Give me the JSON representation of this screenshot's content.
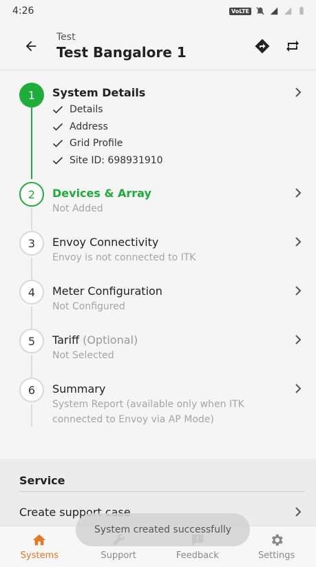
{
  "status_bar": {
    "time": "4:26",
    "volte": "VoLTE"
  },
  "header": {
    "subtitle": "Test",
    "title": "Test Bangalore 1"
  },
  "steps": [
    {
      "number": "1",
      "title": "System Details",
      "state": "done",
      "checks": [
        "Details",
        "Address",
        "Grid Profile",
        "Site ID: 698931910"
      ]
    },
    {
      "number": "2",
      "title": "Devices & Array",
      "state": "active",
      "subtitle": "Not Added"
    },
    {
      "number": "3",
      "title": "Envoy Connectivity",
      "state": "pending",
      "subtitle": "Envoy is not connected to ITK"
    },
    {
      "number": "4",
      "title": "Meter Configuration",
      "state": "pending",
      "subtitle": "Not Configured"
    },
    {
      "number": "5",
      "title": "Tariff",
      "optional": "(Optional)",
      "state": "pending",
      "subtitle": "Not Selected"
    },
    {
      "number": "6",
      "title": "Summary",
      "state": "pending",
      "subtitle_line1": "System Report (available only when ITK",
      "subtitle_line2": "connected to Envoy via AP Mode)"
    }
  ],
  "service": {
    "title": "Service",
    "create_support_case": "Create support case"
  },
  "toast": {
    "message": "System created successfully"
  },
  "bottom_nav": [
    {
      "label": "Systems",
      "icon": "home-icon",
      "active": true
    },
    {
      "label": "Support",
      "icon": "wrench-icon",
      "active": false
    },
    {
      "label": "Feedback",
      "icon": "feedback-icon",
      "active": false
    },
    {
      "label": "Settings",
      "icon": "gear-icon",
      "active": false
    }
  ],
  "colors": {
    "accent_green": "#1dae3a",
    "nav_active": "#e87722"
  }
}
